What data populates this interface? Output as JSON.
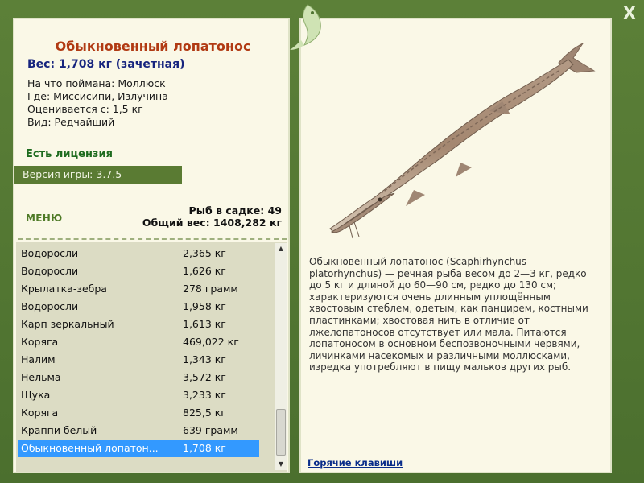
{
  "window": {
    "close_label": "X"
  },
  "fish": {
    "title": "Обыкновенный лопатонос",
    "weight": "Вес: 1,708 кг (зачетная)",
    "bait": "На что поймана: Моллюск",
    "place": "Где: Миссисипи, Излучина",
    "rated_from": "Оценивается с: 1,5 кг",
    "kind": "Вид: Редчайший",
    "description": "Обыкновенный лопатонос (Scaphirhynchus platorhynchus) — речная рыба весом до 2—3 кг, редко до 5 кг и длиной до 60—90 см, редко до 130 см; характеризуются очень длинным уплощённым хвостовым стеблем, одетым, как панцирем, костными пластинками; хвостовая нить в отличие от лжелопатоносов отсутствует или мала. Питаются лопатоносом в основном беспозвоночными червями, личинками насекомых и различными моллюсками, изредка употребляют в пищу мальков других рыб."
  },
  "license": "Есть лицензия",
  "version": "Версия игры: 3.7.5",
  "menu_label": "МЕНЮ",
  "cage": {
    "count_label": "Рыб в садке: 49",
    "total_label": "Общий вес: 1408,282 кг"
  },
  "catch_list": [
    {
      "name": "Водоросли",
      "weight": "2,365 кг"
    },
    {
      "name": "Водоросли",
      "weight": "1,626 кг"
    },
    {
      "name": "Крылатка-зебра",
      "weight": "278 грамм"
    },
    {
      "name": "Водоросли",
      "weight": "1,958 кг"
    },
    {
      "name": "Карп зеркальный",
      "weight": "1,613 кг"
    },
    {
      "name": "Коряга",
      "weight": "469,022 кг"
    },
    {
      "name": "Налим",
      "weight": "1,343 кг"
    },
    {
      "name": "Нельма",
      "weight": "3,572 кг"
    },
    {
      "name": "Щука",
      "weight": "3,233 кг"
    },
    {
      "name": "Коряга",
      "weight": "825,5 кг"
    },
    {
      "name": "Краппи белый",
      "weight": "639 грамм"
    },
    {
      "name": "Обыкновенный лопатон...",
      "weight": "1,708 кг",
      "selected": true
    }
  ],
  "hotkeys_label": "Горячие клавиши",
  "icons": {
    "close": "close-icon",
    "logo": "fish-logo-icon",
    "scroll_up": "scroll-up-icon",
    "scroll_down": "scroll-down-icon"
  },
  "colors": {
    "frame": "#4f7432",
    "panel": "#faf8e7",
    "title": "#b13a13",
    "weight": "#16247e",
    "selection": "#3399ff",
    "version_bar": "#5a7b33"
  }
}
